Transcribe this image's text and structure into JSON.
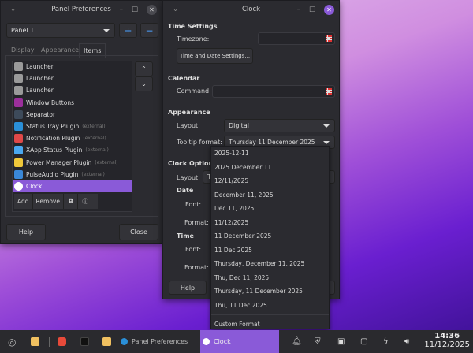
{
  "panel_prefs": {
    "title": "Panel Preferences",
    "panel_select": "Panel 1",
    "add": "+",
    "remove": "−",
    "tabs": [
      "Display",
      "Appearance",
      "Items"
    ],
    "items": [
      {
        "label": "Launcher",
        "ext": "",
        "color": "#9a9a9a"
      },
      {
        "label": "Launcher",
        "ext": "",
        "color": "#9a9a9a"
      },
      {
        "label": "Launcher",
        "ext": "",
        "color": "#9a9a9a"
      },
      {
        "label": "Window Buttons",
        "ext": "",
        "color": "#9b2f9b"
      },
      {
        "label": "Separator",
        "ext": "",
        "color": "#3d4a5a"
      },
      {
        "label": "Status Tray Plugin",
        "ext": "(external)",
        "color": "#2a8fd8"
      },
      {
        "label": "Notification Plugin",
        "ext": "(external)",
        "color": "#e04848"
      },
      {
        "label": "XApp Status Plugin",
        "ext": "(external)",
        "color": "#4aa8f0"
      },
      {
        "label": "Power Manager Plugin",
        "ext": "(external)",
        "color": "#f0c83a"
      },
      {
        "label": "PulseAudio Plugin",
        "ext": "(external)",
        "color": "#3a88d8"
      },
      {
        "label": "Clock",
        "ext": "",
        "color": "#ffffff"
      }
    ],
    "toolbar": {
      "add": "Add",
      "remove": "Remove"
    },
    "help": "Help",
    "close": "Close"
  },
  "clock": {
    "title": "Clock",
    "time_settings": "Time Settings",
    "timezone": "Timezone:",
    "time_date_btn": "Time and Date Settings...",
    "calendar": "Calendar",
    "command": "Command:",
    "appearance": "Appearance",
    "layout": "Layout:",
    "layout_value": "Digital",
    "tooltip_format": "Tooltip format:",
    "tooltip_value": "Thursday 11 December 2025",
    "clock_options": "Clock Options",
    "co_layout": "Layout:",
    "co_layout_value": "T",
    "date": "Date",
    "font": "Font:",
    "format": "Format:",
    "time": "Time",
    "help": "Help"
  },
  "dropdown": [
    "2025-12-11",
    "2025 December 11",
    "12/11/2025",
    "December 11, 2025",
    "Dec 11, 2025",
    "11/12/2025",
    "11 December 2025",
    "11 Dec 2025",
    "Thursday, December 11, 2025",
    "Thu, Dec 11, 2025",
    "Thursday, 11 December 2025",
    "Thu, 11 Dec 2025"
  ],
  "dropdown_custom": "Custom Format",
  "taskbar": {
    "panel_prefs": "Panel Preferences",
    "clock": "Clock",
    "time": "14:36",
    "date": "11/12/2025",
    "accent": "#8a5ad8"
  }
}
